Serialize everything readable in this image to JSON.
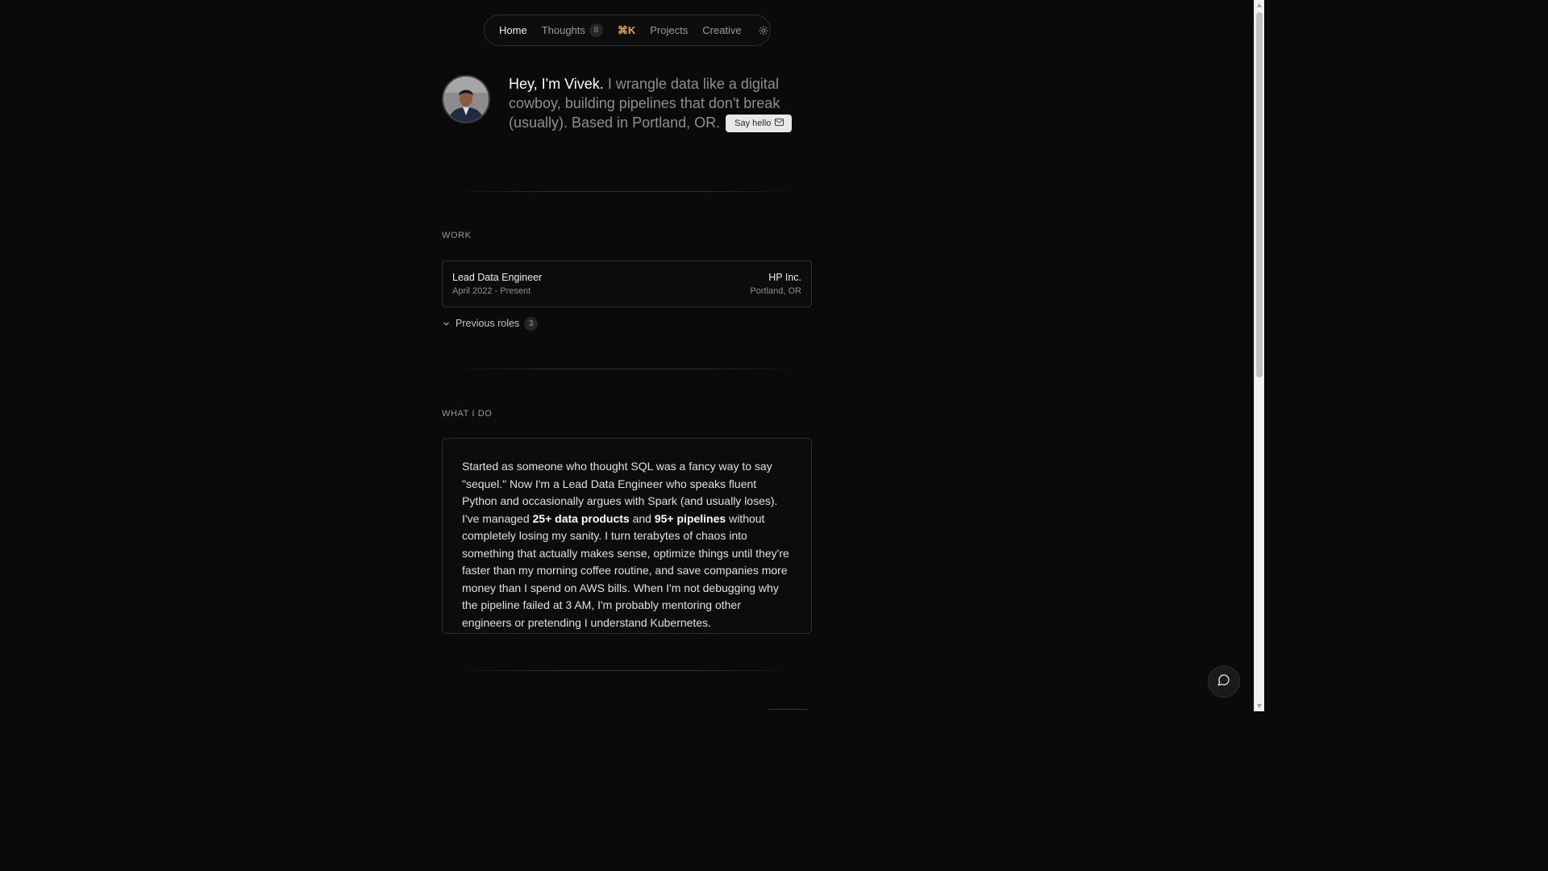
{
  "nav": {
    "home": "Home",
    "thoughts": "Thoughts",
    "thoughts_count": "8",
    "cmdk": "⌘K",
    "projects": "Projects",
    "creative": "Creative",
    "theme_icon": "sun-icon"
  },
  "hero": {
    "greeting": "Hey, I'm Vivek.",
    "intro": " I wrangle data like a digital cowboy, building pipelines that don't break (usually). Based in Portland, OR. ",
    "say_hello": "Say hello",
    "mail_icon": "mail-icon"
  },
  "work": {
    "label": "WORK",
    "current": {
      "title": "Lead Data Engineer",
      "dates": "April 2022 - Present",
      "company": "HP Inc.",
      "location": "Portland, OR"
    },
    "previous_label": "Previous roles",
    "previous_count": "3"
  },
  "what_i_do": {
    "label": "WHAT I DO",
    "p1": "Started as someone who thought SQL was a fancy way to say \"sequel.\" Now I'm a Lead Data Engineer who speaks fluent Python and occasionally argues with Spark (and usually loses). I've managed ",
    "b1": "25+ data products",
    "p2": " and ",
    "b2": "95+ pipelines",
    "p3": " without completely losing my sanity. I turn terabytes of chaos into something that actually makes sense, optimize things until they're faster than my morning coffee routine, and save companies more money than I spend on AWS bills. When I'm not debugging why the pipeline failed at 3 AM, I'm probably mentoring other engineers or pretending I understand Kubernetes."
  },
  "chat": {
    "icon": "chat-bubble-icon"
  },
  "colors": {
    "background": "#0a0a0a",
    "accent": "#e2a84c",
    "border": "#2e2e2e"
  }
}
